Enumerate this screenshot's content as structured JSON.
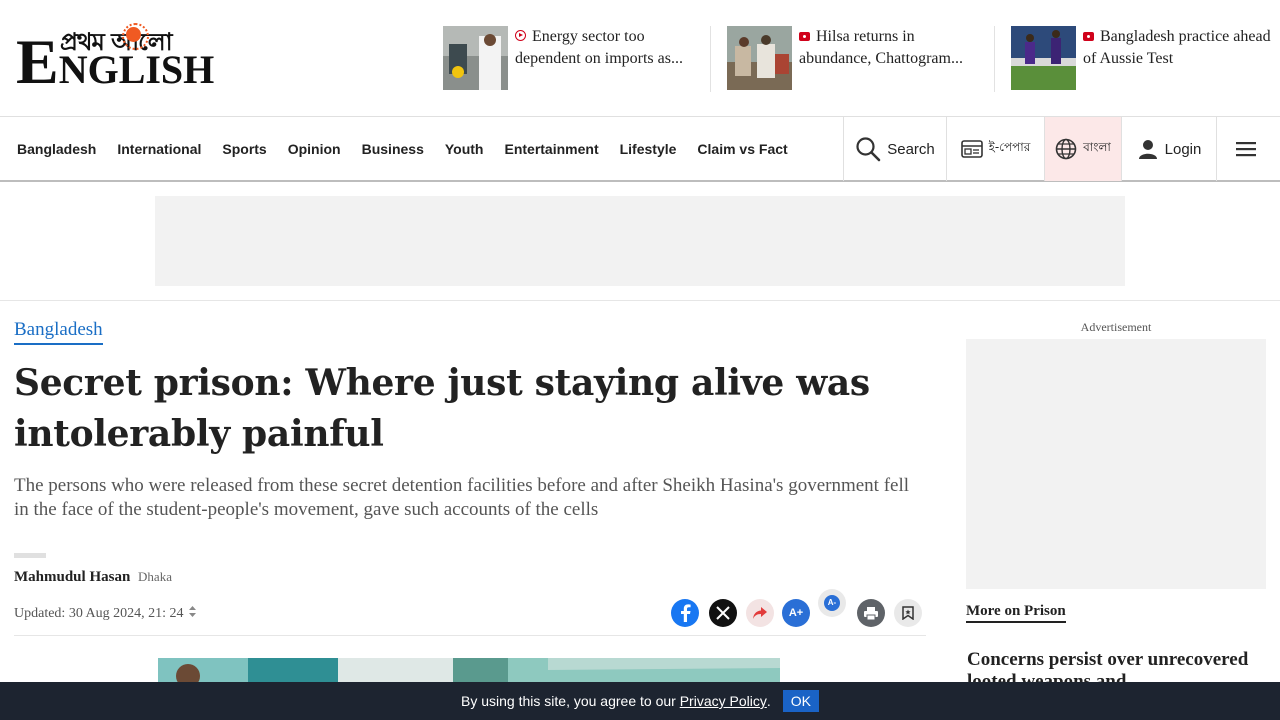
{
  "logo": {
    "bangla_text": "প্রথম আলো",
    "english_text": "ENGLISH"
  },
  "top_stories": [
    {
      "icon": "video-icon",
      "headline": "Energy sector too dependent on imports as..."
    },
    {
      "icon": "photo-icon",
      "headline": "Hilsa returns in abundance, Chattogram..."
    },
    {
      "icon": "photo-icon",
      "headline": "Bangladesh practice ahead of Aussie Test"
    }
  ],
  "nav": {
    "items": [
      "Bangladesh",
      "International",
      "Sports",
      "Opinion",
      "Business",
      "Youth",
      "Entertainment",
      "Lifestyle",
      "Claim vs Fact"
    ],
    "search_label": "Search",
    "epaper_label": "ই-পেপার",
    "bangla_label": "বাংলা",
    "login_label": "Login"
  },
  "article": {
    "section": "Bangladesh",
    "title": "Secret prison: Where just staying alive was intolerably painful",
    "summary": "The persons who were released from these secret detention facilities before and after Sheikh Hasina's government fell in the face of the student-people's movement, gave such accounts of the cells",
    "author": "Mahmudul Hasan",
    "location": "Dhaka",
    "updated": "Updated: 30 Aug 2024, 21: 24"
  },
  "share": {
    "font_increase": "A+",
    "font_decrease": "A-"
  },
  "sidebar": {
    "ad_label": "Advertisement",
    "more_on": "More on Prison",
    "story": "Concerns persist over unrecovered looted weapons and"
  },
  "cookie": {
    "text": "By using this site, you agree to our",
    "link": "Privacy Policy",
    "period": ".",
    "ok": "OK"
  },
  "colors": {
    "accent_blue": "#1a6ec5",
    "brand_red": "#d0021b",
    "facebook": "#1877f2",
    "cookie_bg": "#1d2430"
  }
}
